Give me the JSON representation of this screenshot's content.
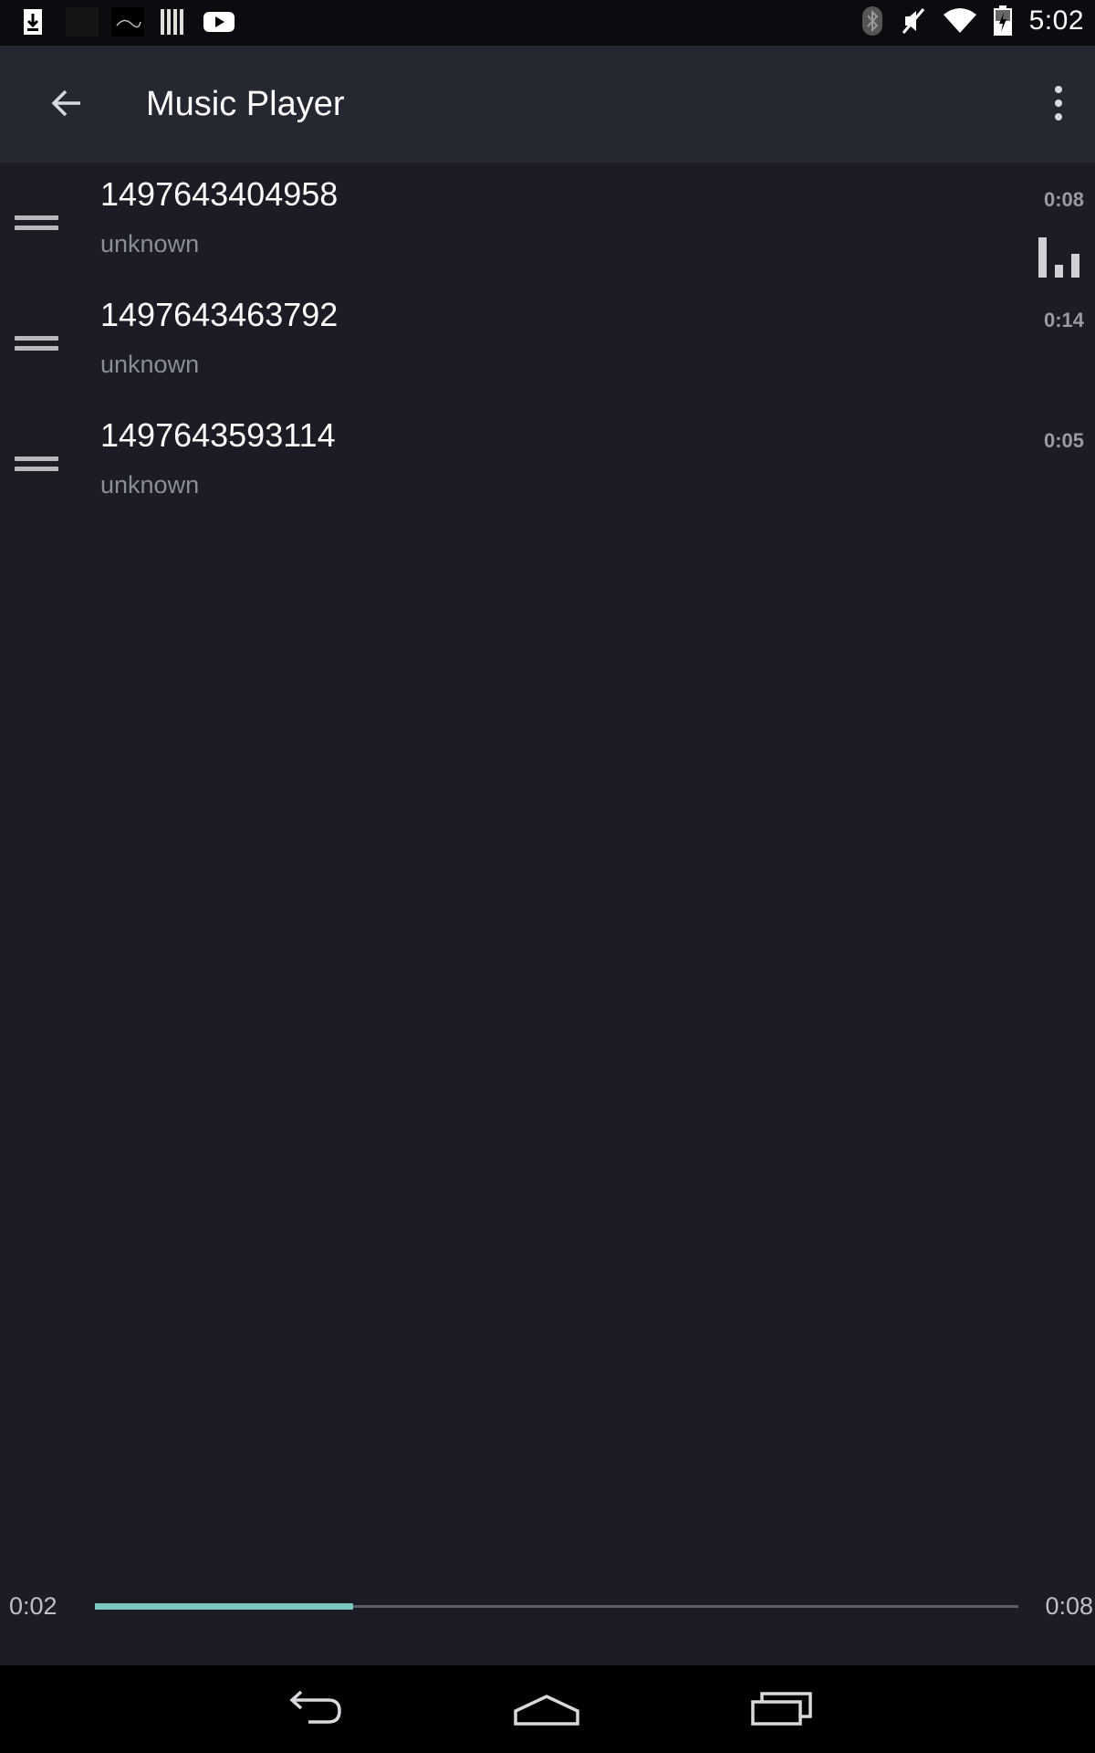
{
  "status_bar": {
    "time": "5:02",
    "left_icons": [
      "download-icon",
      "notification-thumbnail-icon",
      "notification-thumbnail-icon",
      "barcode-icon",
      "youtube-icon"
    ],
    "right_icons": [
      "bluetooth-icon",
      "mute-icon",
      "wifi-icon",
      "battery-charging-icon"
    ]
  },
  "app_bar": {
    "title": "Music Player",
    "back_icon": "arrow-back-icon",
    "menu_icon": "more-vert-icon"
  },
  "queue": [
    {
      "title": "1497643404958",
      "artist": "unknown",
      "duration": "0:08",
      "now_playing": true
    },
    {
      "title": "1497643463792",
      "artist": "unknown",
      "duration": "0:14",
      "now_playing": false
    },
    {
      "title": "1497643593114",
      "artist": "unknown",
      "duration": "0:05",
      "now_playing": false
    }
  ],
  "playback": {
    "elapsed": "0:02",
    "total": "0:08",
    "progress_fraction": 0.28,
    "accent_color": "#7ec8c4"
  },
  "nav_bar": {
    "icons": [
      "back-icon",
      "home-icon",
      "recents-icon"
    ]
  }
}
